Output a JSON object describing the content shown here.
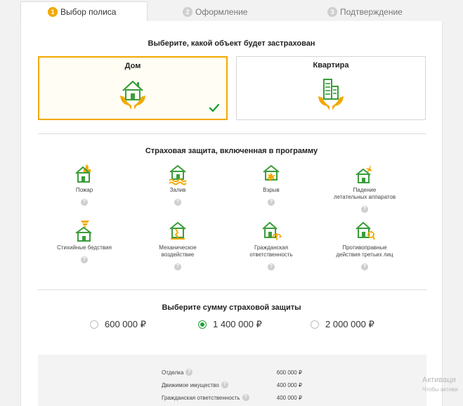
{
  "tabs": [
    {
      "num": "1",
      "label": "Выбор полиса"
    },
    {
      "num": "2",
      "label": "Оформление"
    },
    {
      "num": "3",
      "label": "Подтверждение"
    }
  ],
  "object_section": {
    "title": "Выберите, какой объект будет застрахован",
    "options": [
      {
        "label": "Дом",
        "icon": "house-in-hands-icon",
        "selected": true
      },
      {
        "label": "Квартира",
        "icon": "apartment-in-hands-icon",
        "selected": false
      }
    ]
  },
  "protection": {
    "title": "Страховая защита, включенная в программу",
    "help": "?",
    "risks": [
      {
        "l1": "Пожар",
        "l2": "",
        "icon": "house-fire-icon"
      },
      {
        "l1": "Залив",
        "l2": "",
        "icon": "house-flood-icon"
      },
      {
        "l1": "Взрыв",
        "l2": "",
        "icon": "house-explosion-icon"
      },
      {
        "l1": "Падение",
        "l2": "летательных аппаратов",
        "icon": "house-aircraft-icon"
      },
      {
        "l1": "Стихийные бедствия",
        "l2": "",
        "icon": "house-tornado-icon"
      },
      {
        "l1": "Механическое",
        "l2": "воздействие",
        "icon": "house-damage-icon"
      },
      {
        "l1": "Гражданская",
        "l2": "ответственность",
        "icon": "house-liability-icon"
      },
      {
        "l1": "Противоправные",
        "l2": "действия третьих лиц",
        "icon": "house-theft-icon"
      }
    ]
  },
  "sum_section": {
    "title": "Выберите сумму страховой защиты",
    "options": [
      {
        "label": "600 000 ₽",
        "selected": false
      },
      {
        "label": "1 400 000 ₽",
        "selected": true
      },
      {
        "label": "2 000 000 ₽",
        "selected": false
      }
    ]
  },
  "summary": {
    "help": "?",
    "rows": [
      {
        "label": "Отделка",
        "amount": "600 000  ₽"
      },
      {
        "label": "Движимое имущество",
        "amount": "400 000  ₽"
      },
      {
        "label": "Гражданская ответственность",
        "amount": "400 000  ₽"
      }
    ]
  },
  "watermark": {
    "line1": "Активаци",
    "line2": "Чтобы активи"
  },
  "colors": {
    "accent": "#f2a900",
    "brand_green": "#21a038",
    "house_green": "#3a9d3a"
  }
}
